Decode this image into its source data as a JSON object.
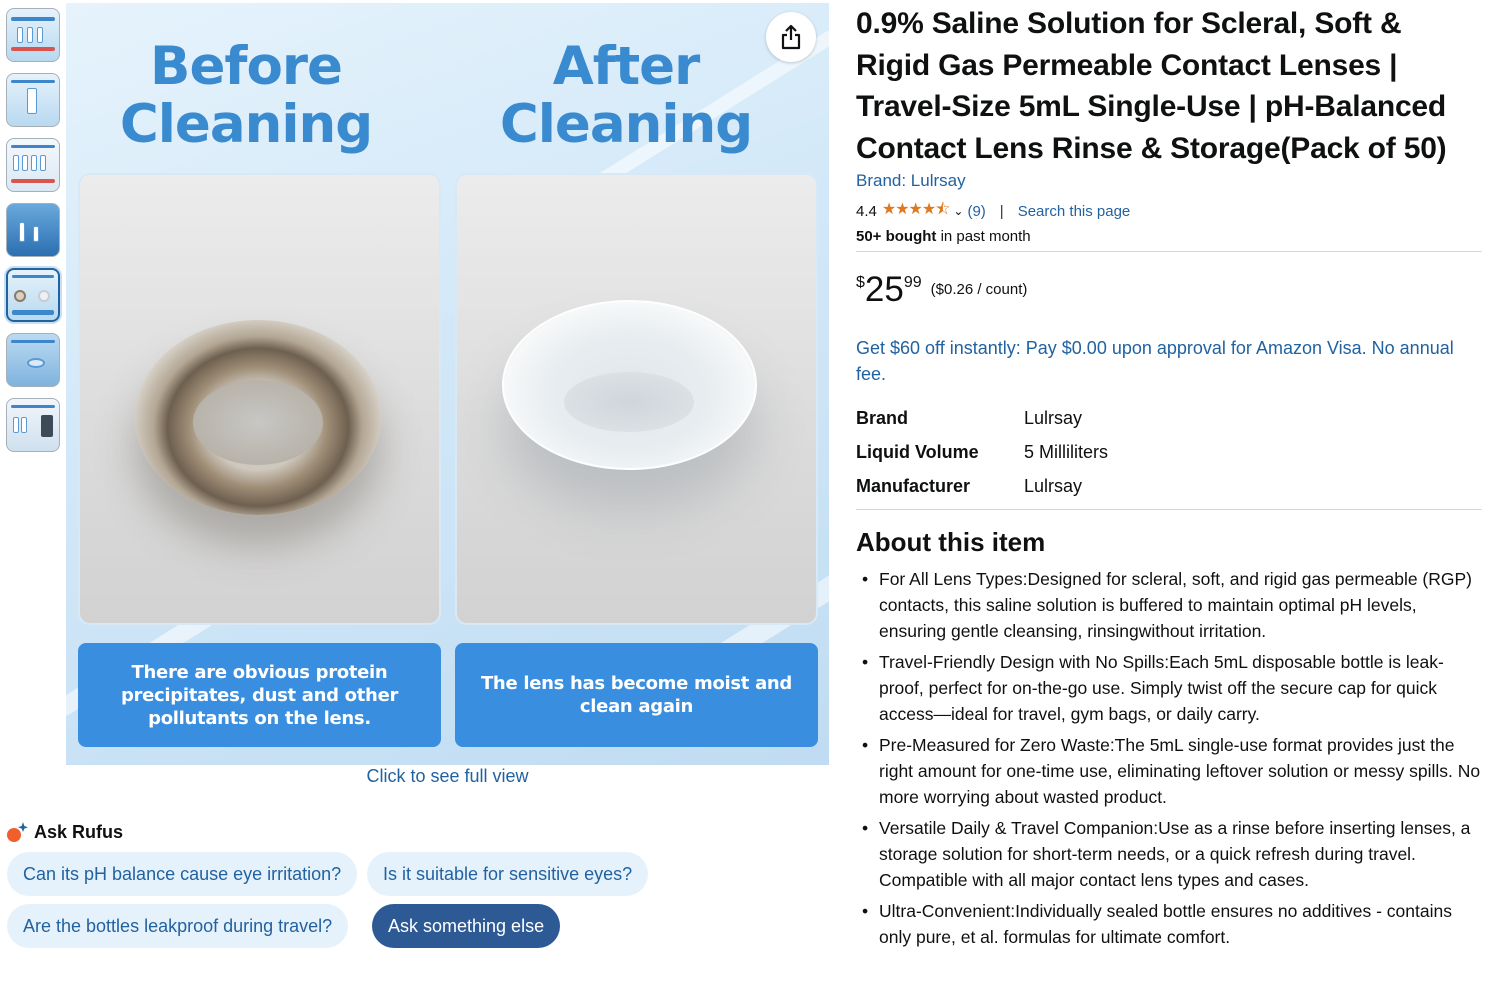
{
  "gallery": {
    "thumb_count": 7,
    "active_index": 4,
    "before_heading_line1": "Before",
    "before_heading_line2": "Cleaning",
    "after_heading_line1": "After",
    "after_heading_line2": "Cleaning",
    "before_caption": "There are obvious protein precipitates, dust and other pollutants on the lens.",
    "after_caption": "The lens has become moist and clean again",
    "click_full_view": "Click to see full view",
    "share_icon": "share-icon"
  },
  "rufus": {
    "title": "Ask Rufus",
    "questions": [
      "Can its pH balance cause eye irritation?",
      "Is it suitable for sensitive eyes?",
      "Are the bottles leakproof during travel?"
    ],
    "ask_else": "Ask something else"
  },
  "product": {
    "title": "0.9% Saline Solution for Scleral, Soft & Rigid Gas Permeable Contact Lenses | Travel-Size 5mL Single-Use | pH-Balanced Contact Lens Rinse & Storage(Pack of 50)",
    "brand_link": "Brand: Lulrsay",
    "rating_value": "4.4",
    "rating_stars": "★★★★⯪",
    "rating_count": "(9)",
    "search_page": "Search this page",
    "bought_bold": "50+ bought",
    "bought_rest": " in past month",
    "price_currency": "$",
    "price_whole": "25",
    "price_fraction": "99",
    "price_unit": "($0.26 / count)",
    "promo": "Get $60 off instantly: Pay $0.00 upon approval for Amazon Visa. No annual fee.",
    "specs": [
      {
        "key": "Brand",
        "value": "Lulrsay"
      },
      {
        "key": "Liquid Volume",
        "value": "5 Milliliters"
      },
      {
        "key": "Manufacturer",
        "value": "Lulrsay"
      }
    ],
    "about_heading": "About this item",
    "about_bullets": [
      "For All Lens Types:Designed for scleral, soft, and rigid gas permeable (RGP) contacts, this saline solution is buffered to maintain optimal pH levels, ensuring gentle cleansing, rinsingwithout irritation.",
      "Travel-Friendly Design with No Spills:Each 5mL disposable bottle is leak-proof, perfect for on-the-go use. Simply twist off the secure cap for quick access—ideal for travel, gym bags, or daily carry.",
      "Pre-Measured for Zero Waste:The 5mL single-use format provides just the right amount for one-time use, eliminating leftover solution or messy spills. No more worrying about wasted product.",
      "Versatile Daily & Travel Companion:Use as a rinse before inserting lenses, a storage solution for short-term needs, or a quick refresh during travel. Compatible with all major contact lens types and cases.",
      "Ultra-Convenient:Individually sealed bottle ensures no additives - contains only pure, et al. formulas for ultimate comfort."
    ]
  },
  "colors": {
    "link": "#2162a1",
    "star": "#de7921",
    "caption_box": "#3a8ee0",
    "heading_blue": "#3a8ad0",
    "chip_bg": "#e6f2fb",
    "chip_primary": "#2d5a94"
  }
}
